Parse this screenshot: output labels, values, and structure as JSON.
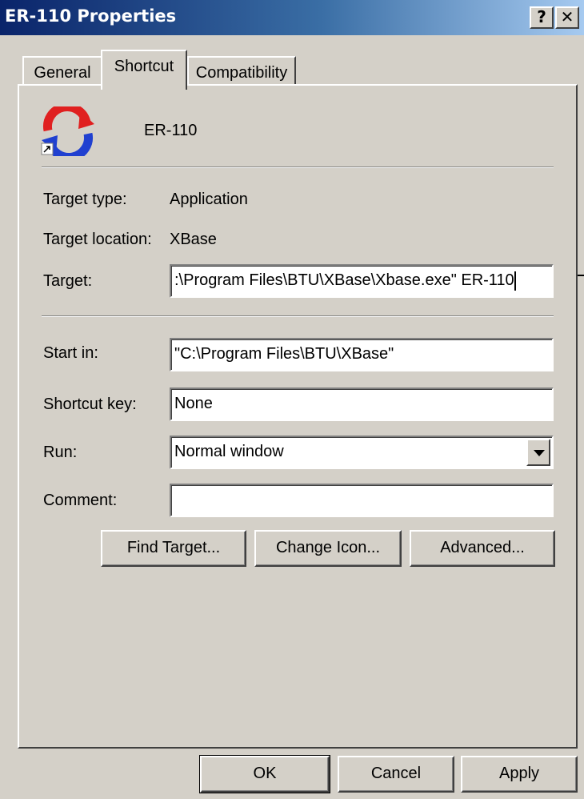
{
  "window": {
    "title": "ER-110 Properties",
    "help_glyph": "?",
    "close_glyph": "✕"
  },
  "tabs": [
    {
      "label": "General",
      "active": false
    },
    {
      "label": "Shortcut",
      "active": true
    },
    {
      "label": "Compatibility",
      "active": false
    }
  ],
  "shortcut": {
    "app_name": "ER-110",
    "app_icon": "refresh-arrows-icon",
    "target_type_label": "Target type:",
    "target_type_value": "Application",
    "target_location_label": "Target location:",
    "target_location_value": "XBase",
    "target_label": "Target:",
    "target_value": ":\\Program Files\\BTU\\XBase\\Xbase.exe\" ER-110",
    "start_in_label": "Start in:",
    "start_in_value": "\"C:\\Program Files\\BTU\\XBase\"",
    "shortcut_key_label": "Shortcut key:",
    "shortcut_key_value": "None",
    "run_label": "Run:",
    "run_value": "Normal window",
    "comment_label": "Comment:",
    "comment_value": "",
    "find_target_label": "Find Target...",
    "change_icon_label": "Change Icon...",
    "advanced_label": "Advanced..."
  },
  "footer": {
    "ok_label": "OK",
    "cancel_label": "Cancel",
    "apply_label": "Apply"
  },
  "colors": {
    "title_gradient_start": "#0a246a",
    "title_gradient_end": "#a6caf0",
    "dialog_face": "#d4d0c8",
    "icon_red": "#e02020",
    "icon_blue": "#2040d0"
  }
}
